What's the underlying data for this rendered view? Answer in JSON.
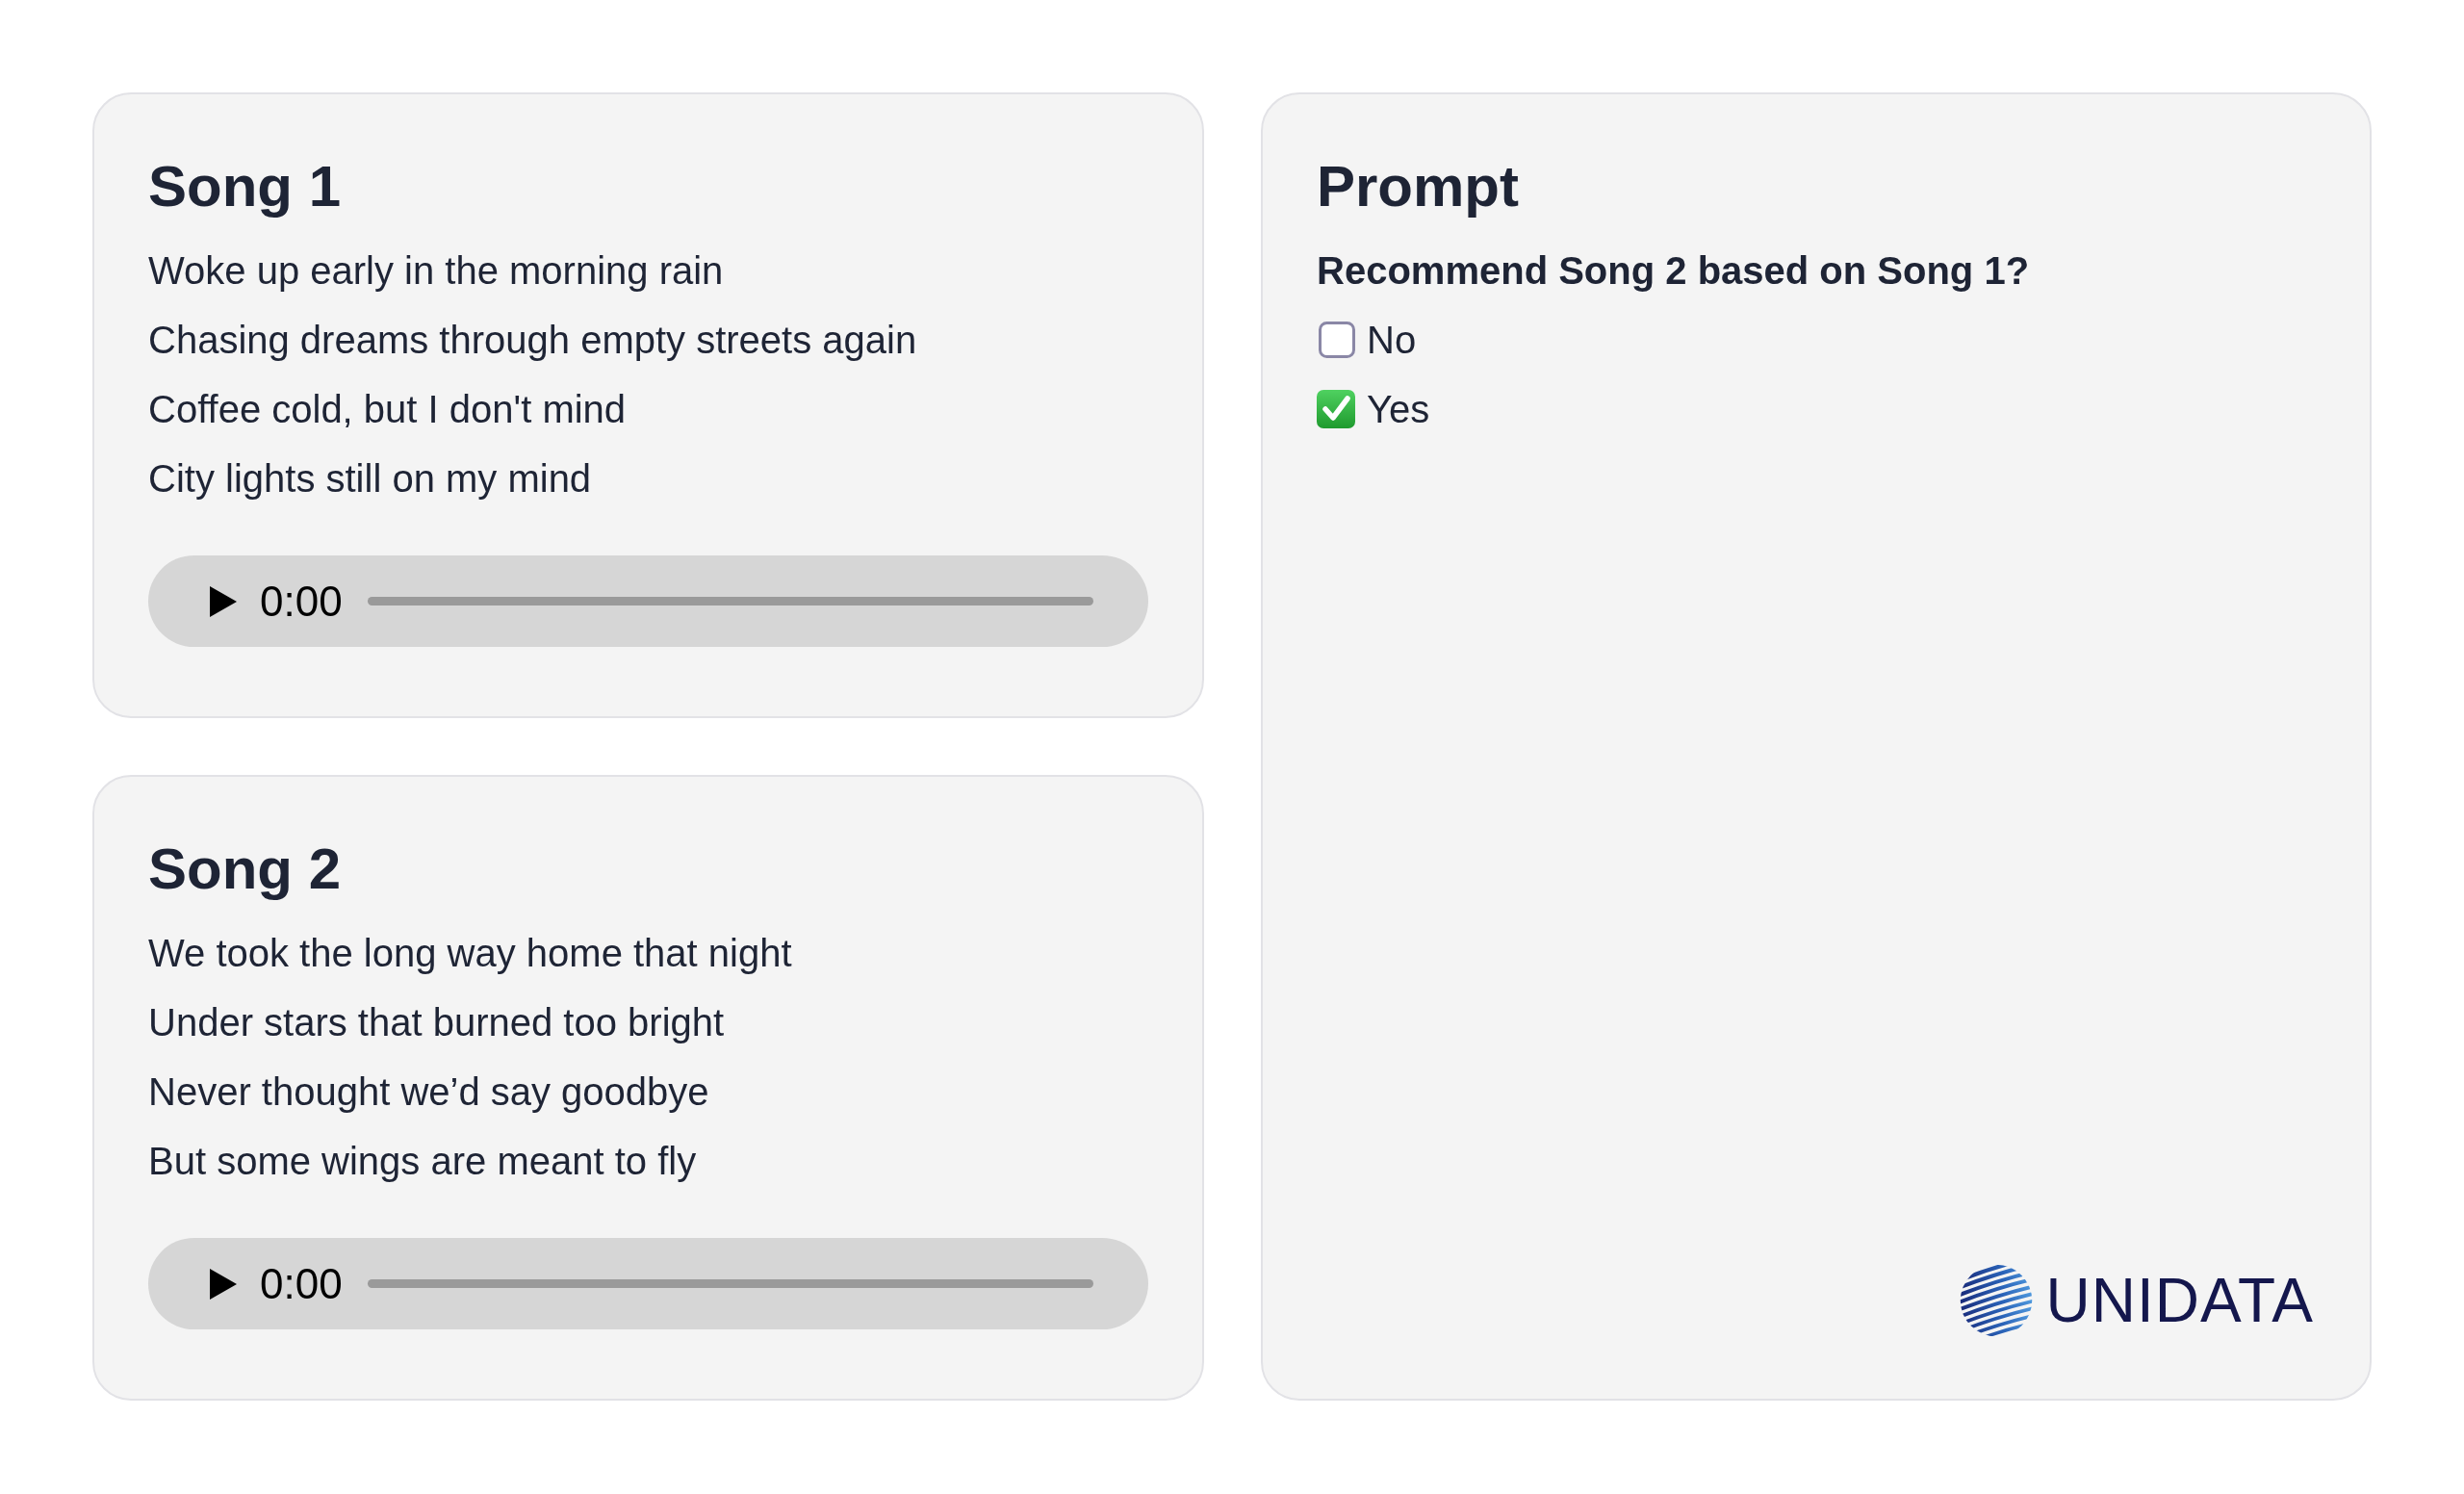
{
  "songs": [
    {
      "title": "Song 1",
      "lyrics": [
        "Woke up early in the morning rain",
        "Chasing dreams through empty streets again",
        "Coffee cold, but I don't mind",
        "City lights still on my mind"
      ],
      "player": {
        "time": "0:00"
      }
    },
    {
      "title": "Song 2",
      "lyrics": [
        "We took the long way home that night",
        "Under stars that burned too bright",
        "Never thought we’d say goodbye",
        "But some wings are meant to fly"
      ],
      "player": {
        "time": "0:00"
      }
    }
  ],
  "prompt": {
    "title": "Prompt",
    "question": "Recommend Song 2 based on Song 1?",
    "options": [
      {
        "label": "No",
        "checked": false
      },
      {
        "label": "Yes",
        "checked": true
      }
    ]
  },
  "logo": {
    "text": "UNIDATA"
  }
}
